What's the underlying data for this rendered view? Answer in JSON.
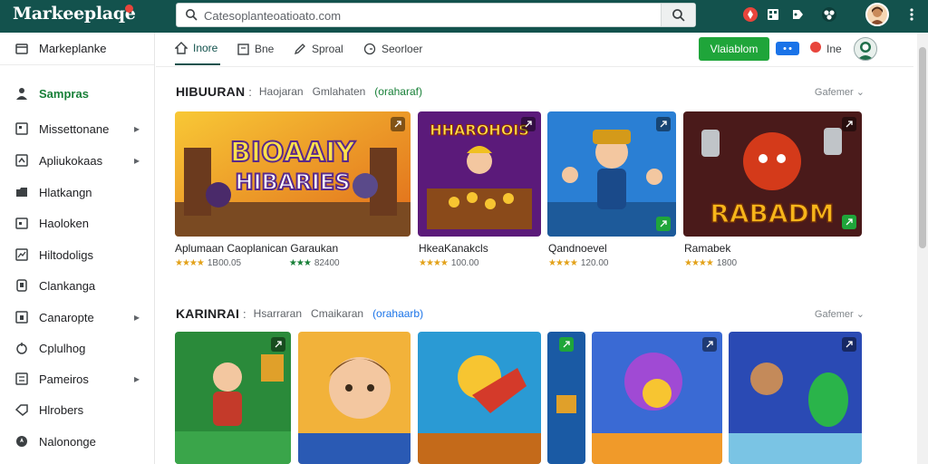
{
  "app": {
    "logo": "Markeeplaqe"
  },
  "search": {
    "value": "Catesoplanteoatioato.com"
  },
  "colors": {
    "brand": "#13524d",
    "accent": "#1fa53a",
    "link_accent": "#188038",
    "star": "#e3a21a"
  },
  "sidebar": {
    "items": [
      {
        "label": "Markeplanke",
        "icon": "store-icon"
      },
      {
        "label": "Sampras",
        "icon": "person-icon"
      },
      {
        "label": "Missettonane",
        "icon": "grid-icon"
      },
      {
        "label": "Apliukokaas",
        "icon": "apps-icon"
      },
      {
        "label": "Hlatkangn",
        "icon": "folder-icon"
      },
      {
        "label": "Haoloken",
        "icon": "calendar-icon"
      },
      {
        "label": "Hiltodoligs",
        "icon": "chart-icon"
      },
      {
        "label": "Clankanga",
        "icon": "book-icon"
      },
      {
        "label": "Canaropte",
        "icon": "lock-icon"
      },
      {
        "label": "Cplulhog",
        "icon": "cart-icon"
      },
      {
        "label": "Pameiros",
        "icon": "list-icon"
      },
      {
        "label": "Hlrobers",
        "icon": "tag-icon"
      },
      {
        "label": "Nalononge",
        "icon": "compass-icon"
      }
    ]
  },
  "tabs": [
    {
      "label": "Inore",
      "icon": "home-icon"
    },
    {
      "label": "Bne",
      "icon": "box-icon"
    },
    {
      "label": "Sproal",
      "icon": "pen-icon"
    },
    {
      "label": "Seorloer",
      "icon": "clock-icon"
    }
  ],
  "header_actions": {
    "install_label": "Vlaiablom",
    "me_label": "Ine"
  },
  "sections": [
    {
      "title": "HIBUURAN",
      "links": [
        "Haojaran",
        "Gmlahaten",
        "(oraharaf)"
      ],
      "more": "Gafemer",
      "cards": [
        {
          "title": "Aplumaan Caoplanican Garaukan",
          "stars": "★★★★",
          "rating": "1B00.05",
          "extra_stars": "★★★",
          "extra_rating": "82400"
        },
        {
          "title": "HkeaKanakcls",
          "stars": "★★★★",
          "rating": "100.00"
        },
        {
          "title": "Qandnoevel",
          "stars": "★★★★",
          "rating": "120.00"
        },
        {
          "title": "Ramabek",
          "stars": "★★★★",
          "rating": "1800"
        }
      ]
    },
    {
      "title": "KARINRAI",
      "links": [
        "Hsarraran",
        "Cmaikaran",
        "(orahaarb)"
      ],
      "more": "Gafemer"
    }
  ]
}
